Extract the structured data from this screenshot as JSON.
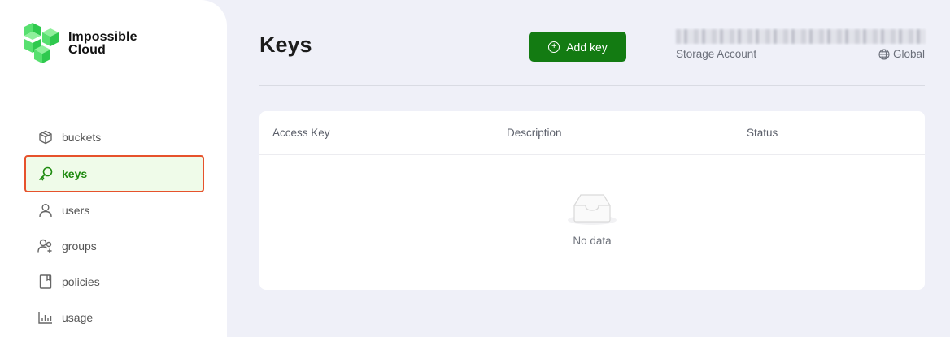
{
  "brand": {
    "line1": "Impossible",
    "line2": "Cloud"
  },
  "sidebar": {
    "items": [
      {
        "label": "buckets",
        "icon": "cube-icon"
      },
      {
        "label": "keys",
        "icon": "key-icon",
        "active": true
      },
      {
        "label": "users",
        "icon": "user-icon"
      },
      {
        "label": "groups",
        "icon": "users-group-icon"
      },
      {
        "label": "policies",
        "icon": "book-icon"
      },
      {
        "label": "usage",
        "icon": "bar-chart-icon"
      }
    ]
  },
  "header": {
    "title": "Keys",
    "add_button": "Add key",
    "account_label": "Storage Account",
    "region": "Global"
  },
  "table": {
    "columns": [
      "Access Key",
      "Description",
      "Status"
    ],
    "empty_text": "No data"
  },
  "colors": {
    "accent": "#137b12",
    "active_bg": "#effbe9",
    "highlight_border": "#e6522c",
    "page_bg": "#eff0f8"
  }
}
